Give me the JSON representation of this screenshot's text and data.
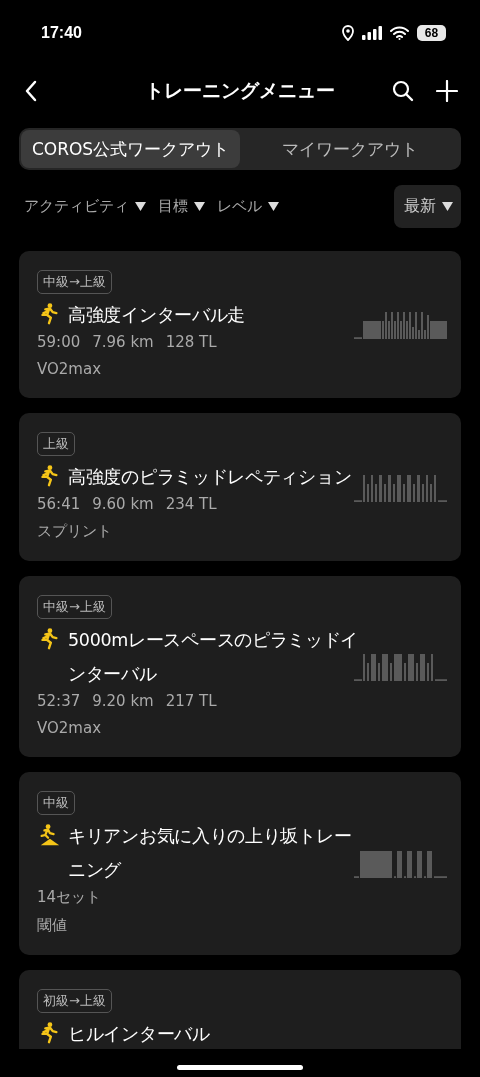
{
  "status_bar": {
    "time": "17:40",
    "battery": "68"
  },
  "header": {
    "title": "トレーニングメニュー"
  },
  "tabs": [
    {
      "label": "COROS公式ワークアウト",
      "selected": true
    },
    {
      "label": "マイワークアウト",
      "selected": false
    }
  ],
  "filters": [
    {
      "label": "アクティビティ"
    },
    {
      "label": "目標"
    },
    {
      "label": "レベル"
    }
  ],
  "sort": {
    "label": "最新"
  },
  "workouts": [
    {
      "level": "中級→上級",
      "kind": "run",
      "title": "高強度インターバル走",
      "stats": [
        "59:00",
        "7.96 km",
        "128 TL"
      ],
      "goal": "VO2max"
    },
    {
      "level": "上級",
      "kind": "run",
      "title": "高強度のピラミッドレペティション",
      "stats": [
        "56:41",
        "9.60 km",
        "234 TL"
      ],
      "goal": "スプリント"
    },
    {
      "level": "中級→上級",
      "kind": "run",
      "title": "5000mレースペースのピラミッドインターバル",
      "stats": [
        "52:37",
        "9.20 km",
        "217 TL"
      ],
      "goal": "VO2max"
    },
    {
      "level": "中級",
      "kind": "hill_run",
      "title": "キリアンお気に入りの上り坂トレーニング",
      "stats": [
        "14セット"
      ],
      "goal": "閾値"
    },
    {
      "level": "初級→上級",
      "kind": "run",
      "title": "ヒルインターバル"
    }
  ]
}
